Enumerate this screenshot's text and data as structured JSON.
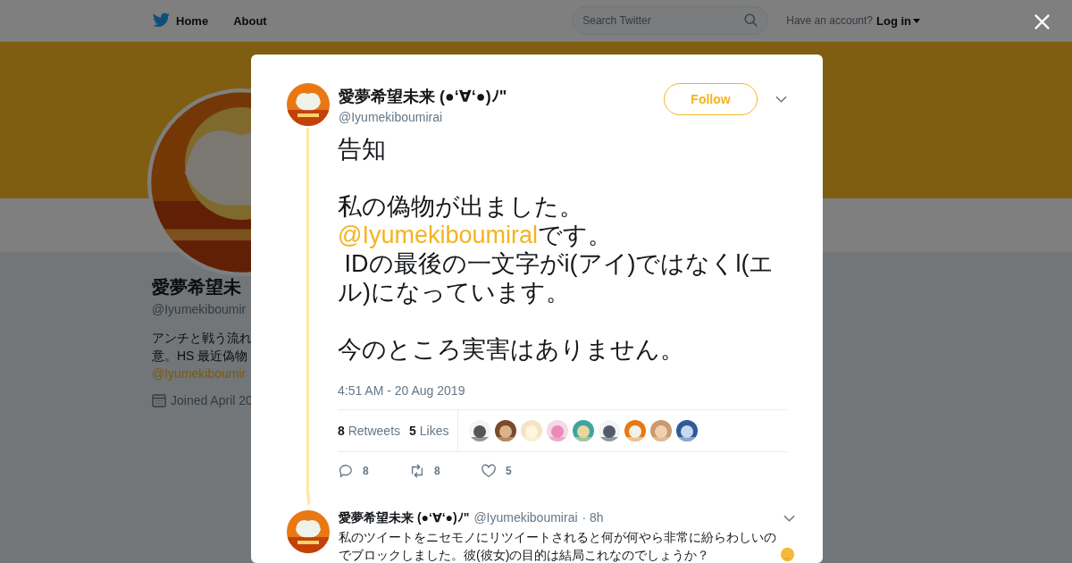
{
  "nav": {
    "links": [
      {
        "label": "Home",
        "kind": "home"
      },
      {
        "label": "About",
        "kind": "plain"
      }
    ],
    "search": {
      "placeholder": "Search Twitter"
    },
    "account_prompt": "Have an account?",
    "login": "Log in"
  },
  "profile": {
    "name": "愛夢希望未",
    "handle": "@Iyumekiboumir",
    "bio_lines": [
      "アンチと戦う流れ",
      "意。HS 最近偽物"
    ],
    "link": "@Iyumekiboumir",
    "joined": "Joined April 20"
  },
  "tweet": {
    "name": "愛夢希望未来 (●‘∀‘●)ﾉ\"",
    "handle": "@Iyumekiboumirai",
    "follow": "Follow",
    "paragraphs": [
      [
        [
          {
            "kind": "text",
            "text": "告知"
          }
        ]
      ],
      [
        [
          {
            "kind": "text",
            "text": "私の偽物が出ました。"
          }
        ],
        [
          {
            "kind": "mention",
            "text": "@Iyumekiboumiral"
          },
          {
            "kind": "text",
            "text": "です。"
          }
        ],
        [
          {
            "kind": "text",
            "text": " IDの最後の一文字がi(アイ)ではなくl(エル)になっています。"
          }
        ]
      ],
      [
        [
          {
            "kind": "text",
            "text": "今のところ実害はありません。"
          }
        ]
      ]
    ],
    "time": "4:51 AM - 20 Aug 2019",
    "retweets": {
      "count": "8",
      "label": "Retweets"
    },
    "likes": {
      "count": "5",
      "label": "Likes"
    },
    "likers": [
      {
        "kind": "picture"
      },
      {
        "kind": "picture"
      },
      {
        "kind": "picture"
      },
      {
        "kind": "picture"
      },
      {
        "kind": "picture"
      },
      {
        "kind": "picture"
      },
      {
        "kind": "picture"
      },
      {
        "kind": "picture"
      },
      {
        "kind": "picture"
      }
    ],
    "actions": [
      {
        "kind": "reply",
        "count": "8"
      },
      {
        "kind": "retweet",
        "count": "8"
      },
      {
        "kind": "like",
        "count": "5"
      }
    ]
  },
  "reply": {
    "name": "愛夢希望未来 (●‘∀‘●)ﾉ\"",
    "handle": "@Iyumekiboumirai",
    "time": "· 8h",
    "text": "私のツイートをニセモノにリツイートされると何が何やら非常に紛らわしいのでブロックしました。彼(彼女)の目的は結局これなのでしょうか？"
  }
}
